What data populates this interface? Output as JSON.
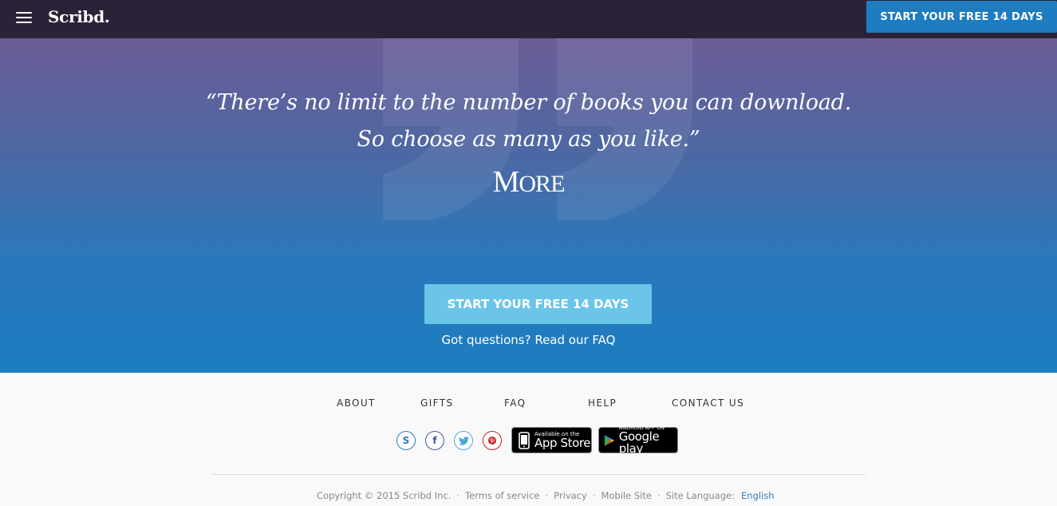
{
  "nav": {
    "logo": "Scribd.",
    "cta_label": "START YOUR FREE 14 DAYS"
  },
  "hero": {
    "quote_line1": "“There’s no limit to the number of books you can download.",
    "quote_line2": "So choose as many as you like.”",
    "source_first": "M",
    "source_rest": "ORE",
    "cta_label": "START YOUR FREE 14 DAYS",
    "faq_text": "Got questions? Read our FAQ"
  },
  "footer": {
    "links": [
      "ABOUT",
      "GIFTS",
      "FAQ",
      "HELP",
      "CONTACT US"
    ],
    "social": [
      {
        "icon": "scribd-icon",
        "glyph": "S",
        "color": "#2a7bbd"
      },
      {
        "icon": "facebook-icon",
        "glyph": "f",
        "color": "#3b5998"
      },
      {
        "icon": "twitter-icon",
        "glyph": "t",
        "color": "#4fa6de"
      },
      {
        "icon": "pinterest-icon",
        "glyph": "p",
        "color": "#cb2027"
      }
    ],
    "app_store": {
      "small": "Available on the",
      "big": "App Store"
    },
    "google_play": {
      "small": "ANDROID APP ON",
      "big": "Google play"
    },
    "copyright": "Copyright © 2015 Scribd Inc.",
    "terms": "Terms of service",
    "privacy": "Privacy",
    "mobile": "Mobile Site",
    "language_label": "Site Language:",
    "language_value": "English"
  },
  "colors": {
    "nav_bg": "#2b2238",
    "accent": "#1e7cc0",
    "hero_cta": "#6bc5e8"
  }
}
